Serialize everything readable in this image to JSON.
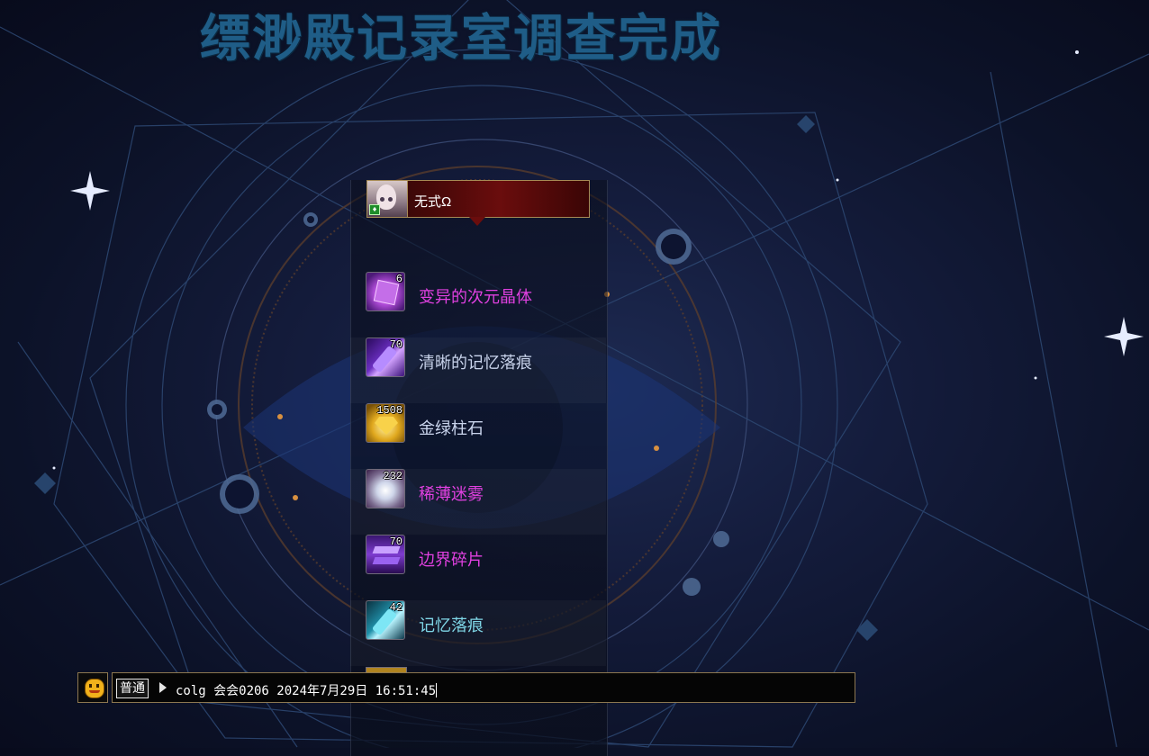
{
  "title": "缥渺殿记录室调查完成",
  "player": {
    "name": "无式Ω"
  },
  "items": [
    {
      "name": "变异的次元晶体",
      "count": "6",
      "color": "#e040e0",
      "icon": "purple-crystal-cube-icon"
    },
    {
      "name": "清晰的记忆落痕",
      "count": "70",
      "color": "#c9d4ec",
      "icon": "purple-memory-shard-icon"
    },
    {
      "name": "金绿柱石",
      "count": "1508",
      "color": "#c9d4ec",
      "icon": "gold-gem-icon"
    },
    {
      "name": "稀薄迷雾",
      "count": "232",
      "color": "#e040e0",
      "icon": "white-mist-orb-icon"
    },
    {
      "name": "边界碎片",
      "count": "70",
      "color": "#e040e0",
      "icon": "purple-fragment-icon"
    },
    {
      "name": "记忆落痕",
      "count": "42",
      "color": "#7fd6e6",
      "icon": "cyan-memory-shard-icon"
    }
  ],
  "chat": {
    "channel": "普通",
    "text": "colg 会会0206 2024年7月29日 16:51:45"
  }
}
